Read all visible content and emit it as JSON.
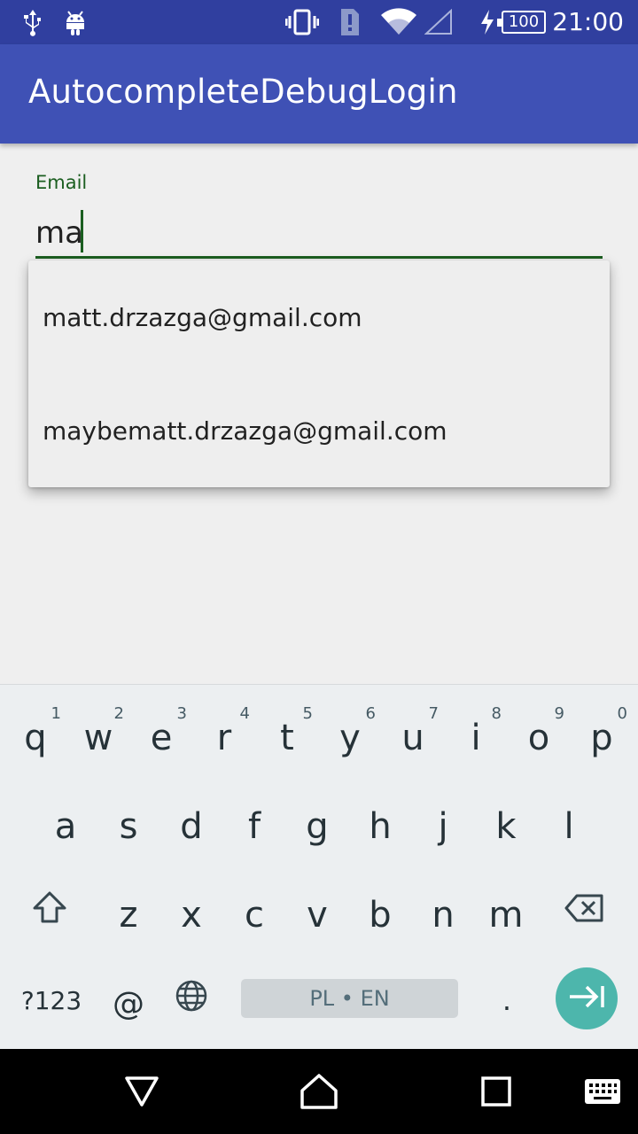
{
  "status_bar": {
    "time": "21:00",
    "battery": "100",
    "icons": [
      "usb-icon",
      "android-debug-icon",
      "vibrate-icon",
      "sim-alert-icon",
      "wifi-icon",
      "cell-signal-icon",
      "charging-icon",
      "battery-icon"
    ]
  },
  "app_bar": {
    "title": "AutocompleteDebugLogin"
  },
  "email": {
    "label": "Email",
    "value": "ma"
  },
  "suggestions": [
    "matt.drzazga@gmail.com",
    "maybematt.drzazga@gmail.com"
  ],
  "keyboard": {
    "row1": [
      {
        "letter": "q",
        "hint": "1"
      },
      {
        "letter": "w",
        "hint": "2"
      },
      {
        "letter": "e",
        "hint": "3"
      },
      {
        "letter": "r",
        "hint": "4"
      },
      {
        "letter": "t",
        "hint": "5"
      },
      {
        "letter": "y",
        "hint": "6"
      },
      {
        "letter": "u",
        "hint": "7"
      },
      {
        "letter": "i",
        "hint": "8"
      },
      {
        "letter": "o",
        "hint": "9"
      },
      {
        "letter": "p",
        "hint": "0"
      }
    ],
    "row2": [
      "a",
      "s",
      "d",
      "f",
      "g",
      "h",
      "j",
      "k",
      "l"
    ],
    "row3": [
      "z",
      "x",
      "c",
      "v",
      "b",
      "n",
      "m"
    ],
    "symbols_label": "?123",
    "at_label": "@",
    "space_label": "PL • EN",
    "period_label": "."
  },
  "colors": {
    "status_bar": "#303f9f",
    "app_bar": "#3f51b5",
    "accent": "#1b5e20",
    "enter_key": "#4db6ac"
  }
}
